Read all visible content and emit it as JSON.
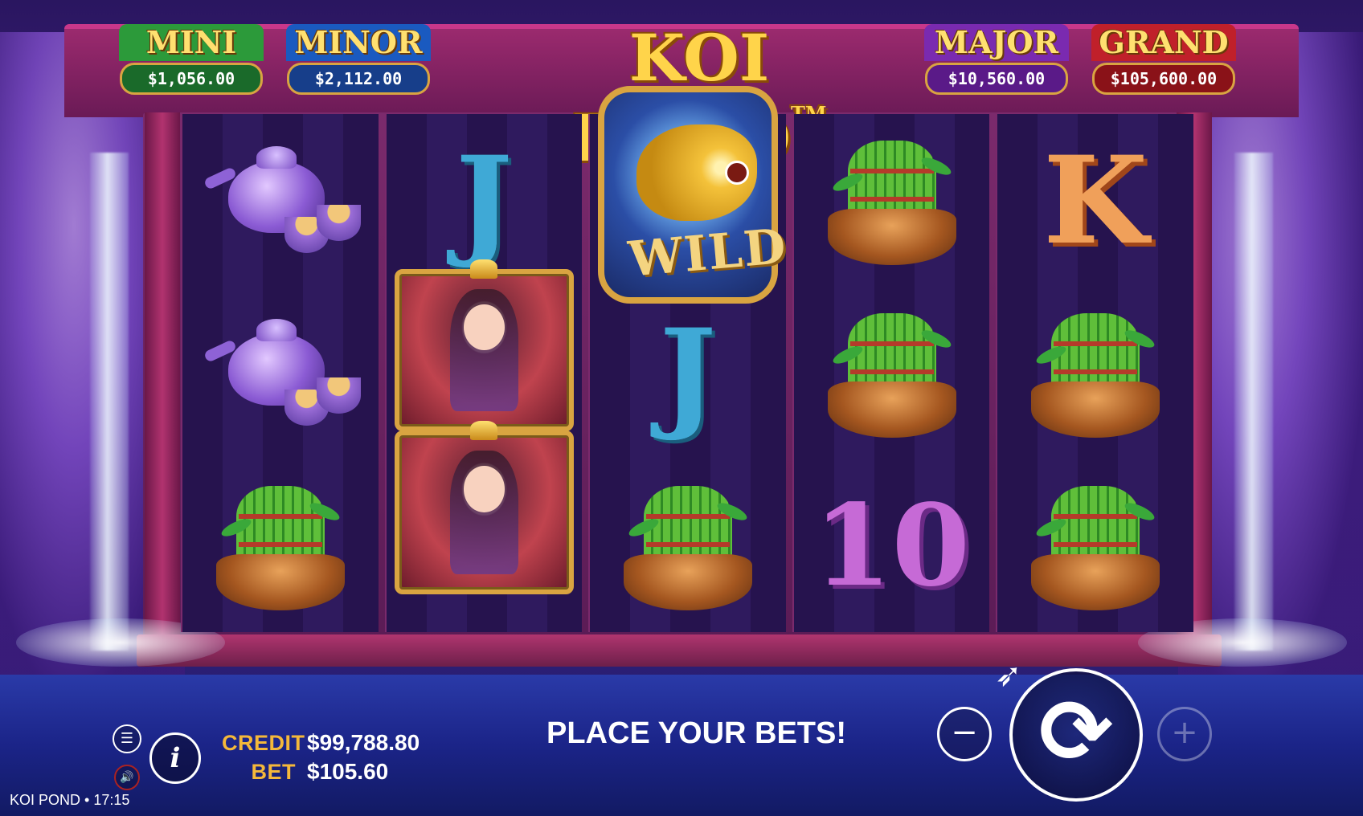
{
  "game": {
    "logo": "KOI POND",
    "trademark": "TM"
  },
  "jackpots": {
    "mini": {
      "name": "MINI",
      "value": "$1,056.00"
    },
    "minor": {
      "name": "MINOR",
      "value": "$2,112.00"
    },
    "major": {
      "name": "MAJOR",
      "value": "$10,560.00"
    },
    "grand": {
      "name": "GRAND",
      "value": "$105,600.00"
    }
  },
  "reels": [
    [
      "teapot",
      "teapot",
      "bamboo-pot"
    ],
    [
      "J",
      "princess",
      "princess"
    ],
    [
      "wild",
      "J",
      "bamboo-pot"
    ],
    [
      "bamboo-pot",
      "bamboo-pot",
      "10"
    ],
    [
      "K",
      "bamboo-pot",
      "bamboo-pot"
    ]
  ],
  "symbols": {
    "j": "J",
    "k": "K",
    "ten": "10",
    "wild": "WILD"
  },
  "hud": {
    "credit_label": "CREDIT",
    "credit_value": "$99,788.80",
    "bet_label": "BET",
    "bet_value": "$105.60",
    "status": "PLACE YOUR BETS!",
    "info_icon": "i",
    "menu_icon": "☰",
    "sound_icon": "🔊",
    "minus_icon": "−",
    "plus_icon": "+",
    "spin_icon": "⟳"
  },
  "footer": {
    "text": "KOI POND • 17:15"
  }
}
